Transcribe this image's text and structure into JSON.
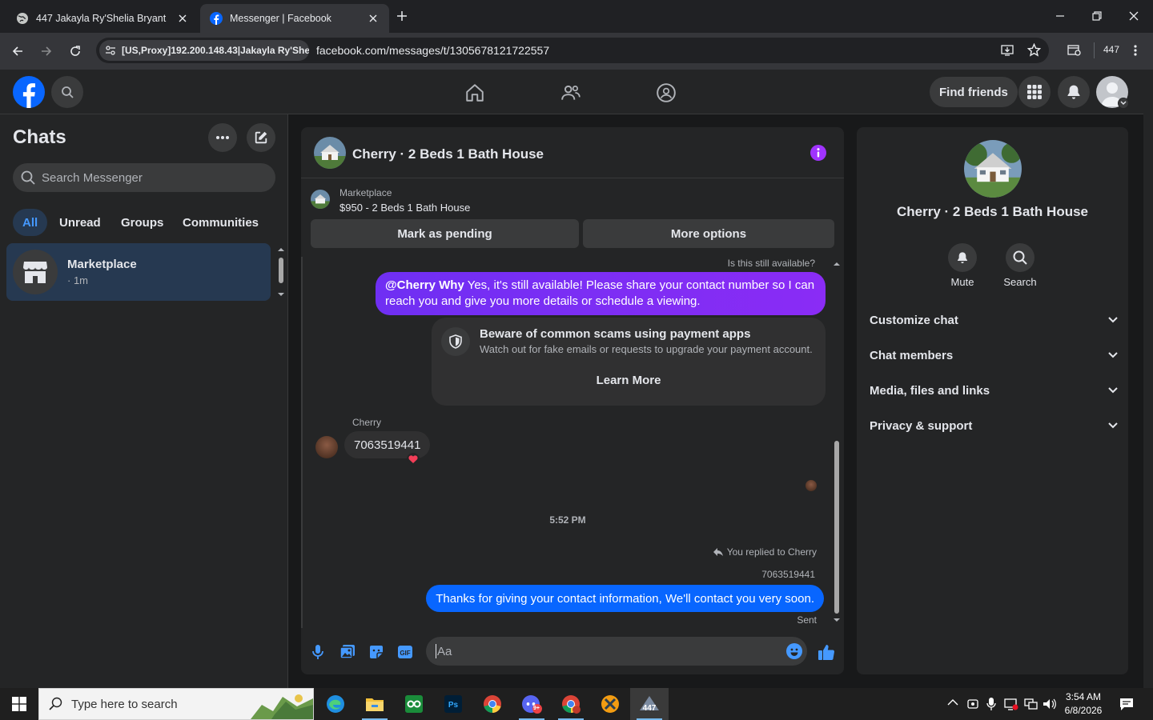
{
  "browser": {
    "tabs": [
      {
        "title": "447 Jakayla Ry'Shelia Bryant",
        "active": false
      },
      {
        "title": "Messenger | Facebook",
        "active": true
      }
    ],
    "proxy_label": "[US,Proxy]192.200.148.43|Jakayla Ry'Shel...",
    "url": "facebook.com/messages/t/1305678121722557",
    "profile_label": "447"
  },
  "fb_header": {
    "find_friends": "Find friends"
  },
  "chats": {
    "title": "Chats",
    "search_placeholder": "Search Messenger",
    "filters": [
      "All",
      "Unread",
      "Groups",
      "Communities"
    ],
    "items": [
      {
        "name": "Marketplace",
        "meta": "· 1m"
      }
    ]
  },
  "conversation": {
    "title": "Cherry · 2 Beds 1 Bath House",
    "listing": {
      "source": "Marketplace",
      "title": "$950 - 2 Beds 1 Bath House"
    },
    "mark_pending": "Mark as pending",
    "more_options": "More options",
    "messages": {
      "quoted_prev": "Is this still available?",
      "outgoing_1_mention": "@Cherry Why",
      "outgoing_1_text": " Yes, it's still available! Please share your contact number so I can reach you and give you more details or schedule a viewing.",
      "scam_title": "Beware of common scams using payment apps",
      "scam_body": "Watch out for fake emails or requests to upgrade your payment account.",
      "scam_button": "Learn More",
      "incoming_sender": "Cherry",
      "incoming_text": "7063519441",
      "timestamp": "5:52 PM",
      "reply_note": "You replied to Cherry",
      "reply_quote": "7063519441",
      "outgoing_2_text": "Thanks for giving your contact information, We'll contact you very soon.",
      "status": "Sent"
    },
    "composer_placeholder": "Aa"
  },
  "details": {
    "name": "Cherry · 2 Beds 1 Bath House",
    "actions": [
      "Mute",
      "Search"
    ],
    "sections": [
      "Customize chat",
      "Chat members",
      "Media, files and links",
      "Privacy & support"
    ]
  },
  "taskbar": {
    "search_placeholder": "Type here to search",
    "time": "3:54 AM",
    "date": "6/8/2026",
    "discord_badge": "9+"
  },
  "colors": {
    "accent_blue": "#0866ff",
    "mention_purple": "#7b2ff7",
    "info_purple": "#a033ff"
  }
}
